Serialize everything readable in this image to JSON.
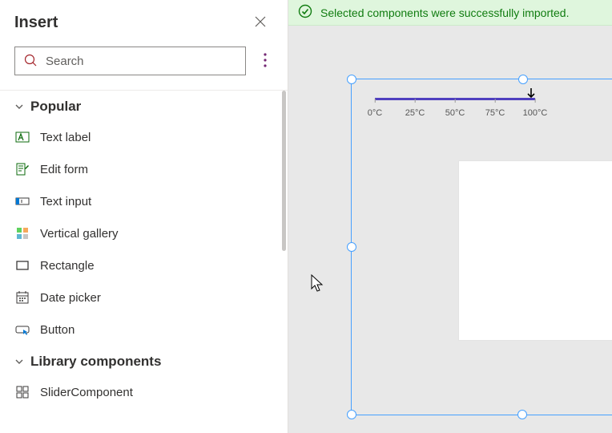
{
  "pane": {
    "title": "Insert",
    "search_placeholder": "Search"
  },
  "groups": {
    "popular": {
      "title": "Popular",
      "items": [
        {
          "label": "Text label"
        },
        {
          "label": "Edit form"
        },
        {
          "label": "Text input"
        },
        {
          "label": "Vertical gallery"
        },
        {
          "label": "Rectangle"
        },
        {
          "label": "Date picker"
        },
        {
          "label": "Button"
        }
      ]
    },
    "library": {
      "title": "Library components",
      "items": [
        {
          "label": "SliderComponent"
        }
      ]
    }
  },
  "toast": {
    "message": "Selected components were successfully imported."
  },
  "slider": {
    "ticks": [
      "0°C",
      "25°C",
      "50°C",
      "75°C",
      "100°C"
    ]
  }
}
